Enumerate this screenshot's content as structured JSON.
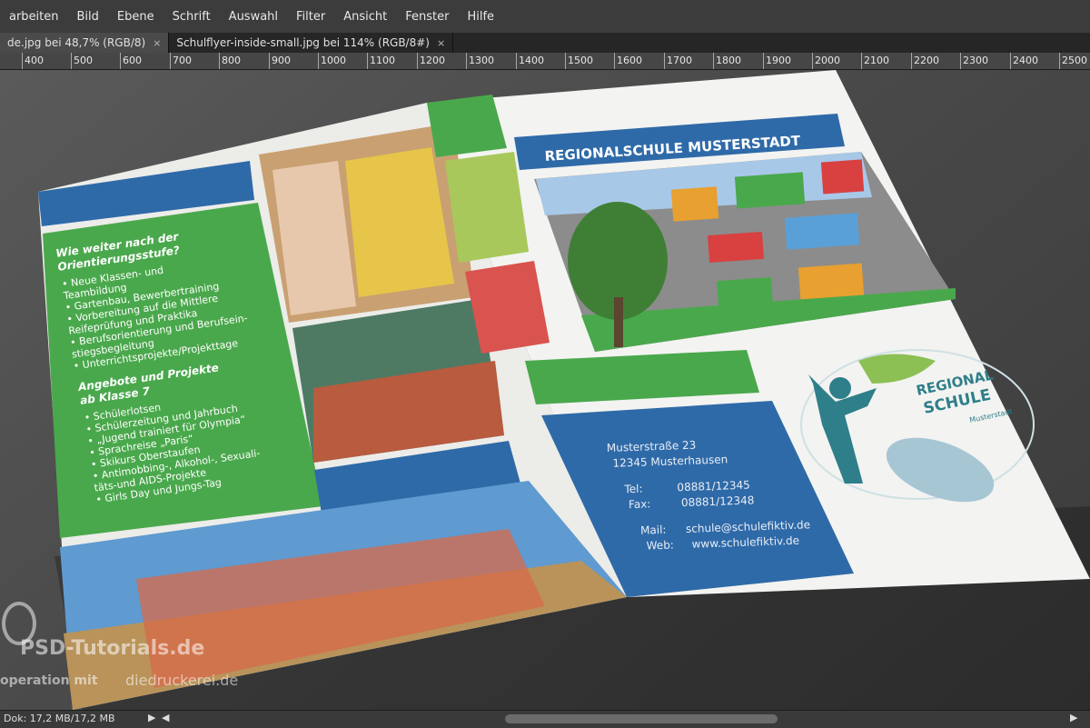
{
  "menu": [
    "arbeiten",
    "Bild",
    "Ebene",
    "Schrift",
    "Auswahl",
    "Filter",
    "Ansicht",
    "Fenster",
    "Hilfe"
  ],
  "tabs": [
    {
      "label": "de.jpg bei 48,7% (RGB/8)",
      "close": "×",
      "active": true
    },
    {
      "label": "Schulflyer-inside-small.jpg bei 114% (RGB/8#)",
      "close": "×",
      "active": false
    }
  ],
  "ruler": [
    "400",
    "500",
    "600",
    "700",
    "800",
    "900",
    "1000",
    "1100",
    "1200",
    "1300",
    "1400",
    "1500",
    "1600",
    "1700",
    "1800",
    "1900",
    "2000",
    "2100",
    "2200",
    "2300",
    "2400",
    "2500"
  ],
  "flyer": {
    "header_title": "REGIONALSCHULE MUSTERSTADT",
    "section1_heading": "Wie weiter nach der Orientierungsstufe?",
    "section1_heading_l1": "Wie weiter nach der",
    "section1_heading_l2": "Orientierungsstufe?",
    "section1_items": [
      "• Neue Klassen- und",
      "  Teambildung",
      "• Gartenbau, Bewerbertraining",
      "• Vorbereitung auf die Mittlere",
      "  Reifeprüfung und Praktika",
      "• Berufsorientierung und Berufsein-",
      "  stiegsbegleitung",
      "• Unterrichtsprojekte/Projekttage"
    ],
    "section2_heading_l1": "Angebote und Projekte",
    "section2_heading_l2": "ab Klasse 7",
    "section2_items": [
      "• Schülerlotsen",
      "• Schülerzeitung und Jahrbuch",
      "• „Jugend trainiert für Olympia“",
      "• Sprachreise „Paris“",
      "• Skikurs Oberstaufen",
      "• Antimobbing-, Alkohol-, Sexuali-",
      "  täts-und AIDS-Projekte",
      "• Girls Day und Jungs-Tag"
    ],
    "address_street": "Musterstraße 23",
    "address_city": "12345 Musterhausen",
    "tel_label": "Tel:",
    "tel": "08881/12345",
    "fax_label": "Fax:",
    "fax": "08881/12348",
    "mail_label": "Mail:",
    "mail": "schule@schulefiktiv.de",
    "web_label": "Web:",
    "web": "www.schulefiktiv.de",
    "logo_line1": "REGIONAL",
    "logo_line2": "SCHULE",
    "logo_line3": "Musterstadt"
  },
  "watermark": {
    "line1": "PSD-Tutorials.de",
    "line2": "operation mit",
    "line3": "diedruckerei.de"
  },
  "status": {
    "doc": "Dok: 17,2 MB/17,2 MB",
    "arrow_right": "▶",
    "arrow_left": "◀",
    "arrow_end": "▶"
  },
  "colors": {
    "blue": "#2f6aa8",
    "green": "#4aa84c",
    "light_green": "#a8c85c",
    "red": "#d9534f",
    "paper": "#f3f3f1"
  }
}
